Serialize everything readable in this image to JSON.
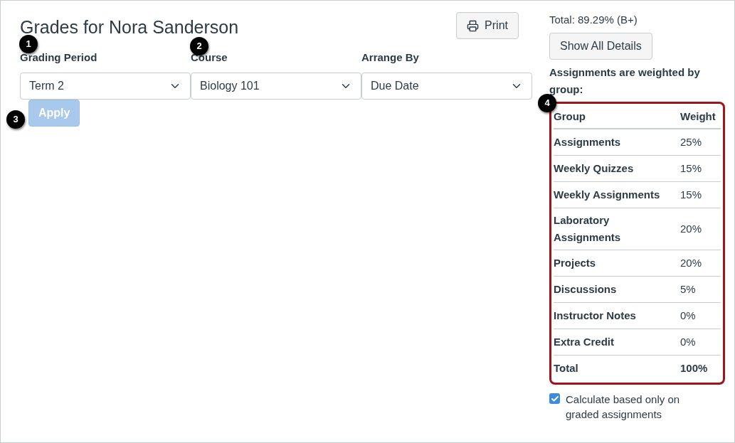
{
  "title": "Grades for Nora Sanderson",
  "print_button": "Print",
  "filters": [
    {
      "label": "Grading Period",
      "value": "Term 2"
    },
    {
      "label": "Course",
      "value": "Biology 101"
    },
    {
      "label": "Arrange By",
      "value": "Due Date"
    }
  ],
  "apply_button": {
    "label": "Apply",
    "disabled": true
  },
  "total": "Total: 89.29% (B+)",
  "details_button": "Show All Details",
  "weighted_note": "Assignments are weighted by group:",
  "table": {
    "columns": [
      "Group",
      "Weight"
    ],
    "rows": [
      {
        "group": "Assignments",
        "weight": "25%"
      },
      {
        "group": "Weekly Quizzes",
        "weight": "15%"
      },
      {
        "group": "Weekly Assignments",
        "weight": "15%"
      },
      {
        "group": "Laboratory Assignments",
        "weight": "20%"
      },
      {
        "group": "Projects",
        "weight": "20%"
      },
      {
        "group": "Discussions",
        "weight": "5%"
      },
      {
        "group": "Instructor Notes",
        "weight": "0%"
      },
      {
        "group": "Extra Credit",
        "weight": "0%"
      }
    ],
    "total_row": {
      "group": "Total",
      "weight": "100%"
    }
  },
  "graded_only": {
    "label": "Calculate based only on graded assignments",
    "checked": true
  },
  "callouts": [
    "1",
    "2",
    "3",
    "4"
  ]
}
